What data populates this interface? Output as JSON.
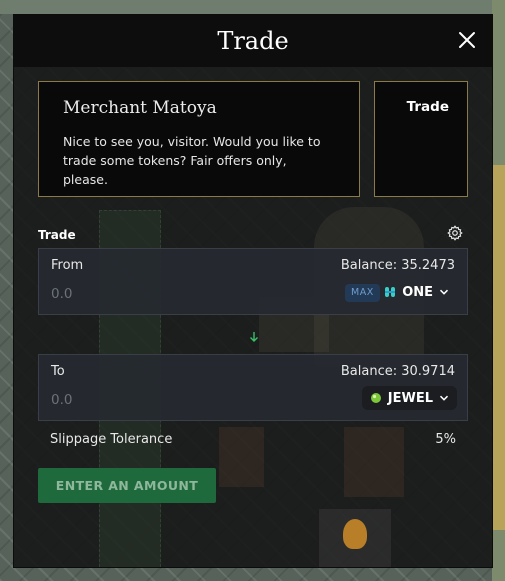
{
  "modal": {
    "title": "Trade"
  },
  "merchant": {
    "name": "Merchant Matoya",
    "greeting": "Nice to see you, visitor. Would you like to trade some tokens? Fair offers only, please."
  },
  "mode": {
    "label": "Trade"
  },
  "trade": {
    "section_label": "Trade",
    "from": {
      "label": "From",
      "balance": "Balance: 35.2473",
      "placeholder": "0.0",
      "max_label": "MAX",
      "token": "ONE",
      "token_icon": "harmony-one-icon"
    },
    "to": {
      "label": "To",
      "balance": "Balance: 30.9714",
      "placeholder": "0.0",
      "token": "JEWEL",
      "token_icon": "jewel-gem-icon"
    },
    "slippage_label": "Slippage Tolerance",
    "slippage_value": "5%",
    "submit_label": "ENTER AN AMOUNT"
  },
  "colors": {
    "accent_green": "#1f6a3c",
    "border_gold": "#8a7a46",
    "max_badge": "#233a56"
  }
}
